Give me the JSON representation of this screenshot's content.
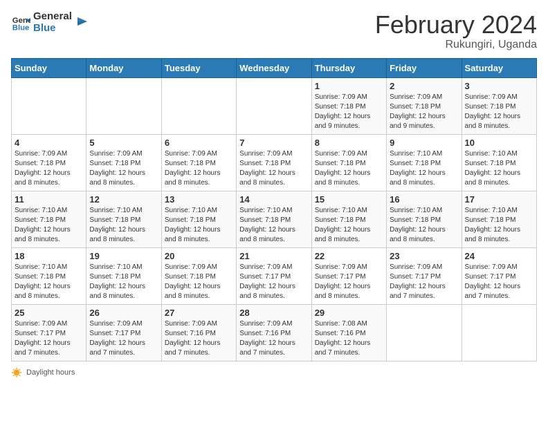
{
  "header": {
    "logo_line1": "General",
    "logo_line2": "Blue",
    "main_title": "February 2024",
    "subtitle": "Rukungiri, Uganda"
  },
  "days_of_week": [
    "Sunday",
    "Monday",
    "Tuesday",
    "Wednesday",
    "Thursday",
    "Friday",
    "Saturday"
  ],
  "weeks": [
    [
      {
        "num": "",
        "info": ""
      },
      {
        "num": "",
        "info": ""
      },
      {
        "num": "",
        "info": ""
      },
      {
        "num": "",
        "info": ""
      },
      {
        "num": "1",
        "info": "Sunrise: 7:09 AM\nSunset: 7:18 PM\nDaylight: 12 hours\nand 9 minutes."
      },
      {
        "num": "2",
        "info": "Sunrise: 7:09 AM\nSunset: 7:18 PM\nDaylight: 12 hours\nand 9 minutes."
      },
      {
        "num": "3",
        "info": "Sunrise: 7:09 AM\nSunset: 7:18 PM\nDaylight: 12 hours\nand 8 minutes."
      }
    ],
    [
      {
        "num": "4",
        "info": "Sunrise: 7:09 AM\nSunset: 7:18 PM\nDaylight: 12 hours\nand 8 minutes."
      },
      {
        "num": "5",
        "info": "Sunrise: 7:09 AM\nSunset: 7:18 PM\nDaylight: 12 hours\nand 8 minutes."
      },
      {
        "num": "6",
        "info": "Sunrise: 7:09 AM\nSunset: 7:18 PM\nDaylight: 12 hours\nand 8 minutes."
      },
      {
        "num": "7",
        "info": "Sunrise: 7:09 AM\nSunset: 7:18 PM\nDaylight: 12 hours\nand 8 minutes."
      },
      {
        "num": "8",
        "info": "Sunrise: 7:09 AM\nSunset: 7:18 PM\nDaylight: 12 hours\nand 8 minutes."
      },
      {
        "num": "9",
        "info": "Sunrise: 7:10 AM\nSunset: 7:18 PM\nDaylight: 12 hours\nand 8 minutes."
      },
      {
        "num": "10",
        "info": "Sunrise: 7:10 AM\nSunset: 7:18 PM\nDaylight: 12 hours\nand 8 minutes."
      }
    ],
    [
      {
        "num": "11",
        "info": "Sunrise: 7:10 AM\nSunset: 7:18 PM\nDaylight: 12 hours\nand 8 minutes."
      },
      {
        "num": "12",
        "info": "Sunrise: 7:10 AM\nSunset: 7:18 PM\nDaylight: 12 hours\nand 8 minutes."
      },
      {
        "num": "13",
        "info": "Sunrise: 7:10 AM\nSunset: 7:18 PM\nDaylight: 12 hours\nand 8 minutes."
      },
      {
        "num": "14",
        "info": "Sunrise: 7:10 AM\nSunset: 7:18 PM\nDaylight: 12 hours\nand 8 minutes."
      },
      {
        "num": "15",
        "info": "Sunrise: 7:10 AM\nSunset: 7:18 PM\nDaylight: 12 hours\nand 8 minutes."
      },
      {
        "num": "16",
        "info": "Sunrise: 7:10 AM\nSunset: 7:18 PM\nDaylight: 12 hours\nand 8 minutes."
      },
      {
        "num": "17",
        "info": "Sunrise: 7:10 AM\nSunset: 7:18 PM\nDaylight: 12 hours\nand 8 minutes."
      }
    ],
    [
      {
        "num": "18",
        "info": "Sunrise: 7:10 AM\nSunset: 7:18 PM\nDaylight: 12 hours\nand 8 minutes."
      },
      {
        "num": "19",
        "info": "Sunrise: 7:10 AM\nSunset: 7:18 PM\nDaylight: 12 hours\nand 8 minutes."
      },
      {
        "num": "20",
        "info": "Sunrise: 7:09 AM\nSunset: 7:18 PM\nDaylight: 12 hours\nand 8 minutes."
      },
      {
        "num": "21",
        "info": "Sunrise: 7:09 AM\nSunset: 7:17 PM\nDaylight: 12 hours\nand 8 minutes."
      },
      {
        "num": "22",
        "info": "Sunrise: 7:09 AM\nSunset: 7:17 PM\nDaylight: 12 hours\nand 8 minutes."
      },
      {
        "num": "23",
        "info": "Sunrise: 7:09 AM\nSunset: 7:17 PM\nDaylight: 12 hours\nand 7 minutes."
      },
      {
        "num": "24",
        "info": "Sunrise: 7:09 AM\nSunset: 7:17 PM\nDaylight: 12 hours\nand 7 minutes."
      }
    ],
    [
      {
        "num": "25",
        "info": "Sunrise: 7:09 AM\nSunset: 7:17 PM\nDaylight: 12 hours\nand 7 minutes."
      },
      {
        "num": "26",
        "info": "Sunrise: 7:09 AM\nSunset: 7:17 PM\nDaylight: 12 hours\nand 7 minutes."
      },
      {
        "num": "27",
        "info": "Sunrise: 7:09 AM\nSunset: 7:16 PM\nDaylight: 12 hours\nand 7 minutes."
      },
      {
        "num": "28",
        "info": "Sunrise: 7:09 AM\nSunset: 7:16 PM\nDaylight: 12 hours\nand 7 minutes."
      },
      {
        "num": "29",
        "info": "Sunrise: 7:08 AM\nSunset: 7:16 PM\nDaylight: 12 hours\nand 7 minutes."
      },
      {
        "num": "",
        "info": ""
      },
      {
        "num": "",
        "info": ""
      }
    ]
  ],
  "footer": {
    "daylight_label": "Daylight hours"
  }
}
